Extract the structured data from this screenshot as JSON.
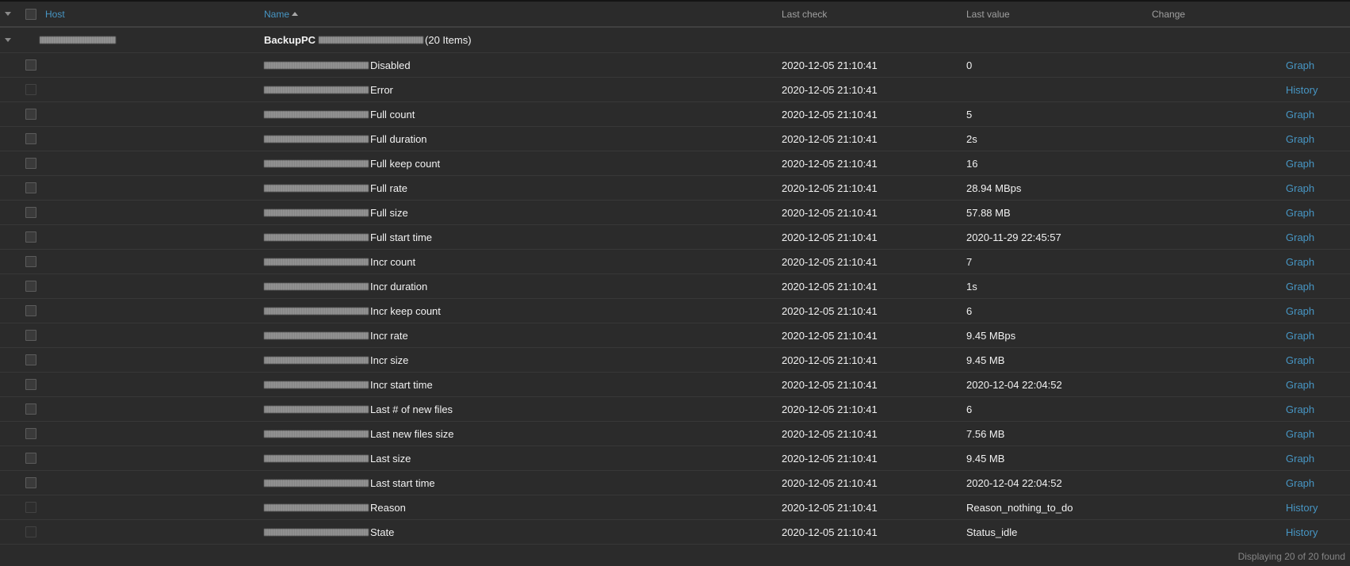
{
  "header": {
    "host": "Host",
    "name": "Name",
    "last_check": "Last check",
    "last_value": "Last value",
    "change": "Change"
  },
  "group": {
    "app_name": "BackupPC",
    "count": "(20 Items)"
  },
  "rows": [
    {
      "name": "Disabled",
      "last_check": "2020-12-05 21:10:41",
      "last_value": "0",
      "action": "Graph",
      "selectable": true
    },
    {
      "name": "Error",
      "last_check": "2020-12-05 21:10:41",
      "last_value": "",
      "action": "History",
      "selectable": false
    },
    {
      "name": "Full count",
      "last_check": "2020-12-05 21:10:41",
      "last_value": "5",
      "action": "Graph",
      "selectable": true
    },
    {
      "name": "Full duration",
      "last_check": "2020-12-05 21:10:41",
      "last_value": "2s",
      "action": "Graph",
      "selectable": true
    },
    {
      "name": "Full keep count",
      "last_check": "2020-12-05 21:10:41",
      "last_value": "16",
      "action": "Graph",
      "selectable": true
    },
    {
      "name": "Full rate",
      "last_check": "2020-12-05 21:10:41",
      "last_value": "28.94 MBps",
      "action": "Graph",
      "selectable": true
    },
    {
      "name": "Full size",
      "last_check": "2020-12-05 21:10:41",
      "last_value": "57.88 MB",
      "action": "Graph",
      "selectable": true
    },
    {
      "name": "Full start time",
      "last_check": "2020-12-05 21:10:41",
      "last_value": "2020-11-29 22:45:57",
      "action": "Graph",
      "selectable": true
    },
    {
      "name": "Incr count",
      "last_check": "2020-12-05 21:10:41",
      "last_value": "7",
      "action": "Graph",
      "selectable": true
    },
    {
      "name": "Incr duration",
      "last_check": "2020-12-05 21:10:41",
      "last_value": "1s",
      "action": "Graph",
      "selectable": true
    },
    {
      "name": "Incr keep count",
      "last_check": "2020-12-05 21:10:41",
      "last_value": "6",
      "action": "Graph",
      "selectable": true
    },
    {
      "name": "Incr rate",
      "last_check": "2020-12-05 21:10:41",
      "last_value": "9.45 MBps",
      "action": "Graph",
      "selectable": true
    },
    {
      "name": "Incr size",
      "last_check": "2020-12-05 21:10:41",
      "last_value": "9.45 MB",
      "action": "Graph",
      "selectable": true
    },
    {
      "name": "Incr start time",
      "last_check": "2020-12-05 21:10:41",
      "last_value": "2020-12-04 22:04:52",
      "action": "Graph",
      "selectable": true
    },
    {
      "name": "Last # of new files",
      "last_check": "2020-12-05 21:10:41",
      "last_value": "6",
      "action": "Graph",
      "selectable": true
    },
    {
      "name": "Last new files size",
      "last_check": "2020-12-05 21:10:41",
      "last_value": "7.56 MB",
      "action": "Graph",
      "selectable": true
    },
    {
      "name": "Last size",
      "last_check": "2020-12-05 21:10:41",
      "last_value": "9.45 MB",
      "action": "Graph",
      "selectable": true
    },
    {
      "name": "Last start time",
      "last_check": "2020-12-05 21:10:41",
      "last_value": "2020-12-04 22:04:52",
      "action": "Graph",
      "selectable": true
    },
    {
      "name": "Reason",
      "last_check": "2020-12-05 21:10:41",
      "last_value": "Reason_nothing_to_do",
      "action": "History",
      "selectable": false
    },
    {
      "name": "State",
      "last_check": "2020-12-05 21:10:41",
      "last_value": "Status_idle",
      "action": "History",
      "selectable": false
    }
  ],
  "footer": {
    "summary": "Displaying 20 of 20 found"
  },
  "colors": {
    "background": "#2b2b2b",
    "link": "#4796c4",
    "header_text": "#a0a0a0",
    "row_border": "#383838"
  },
  "icons": {
    "collapse_all": "chevron-down-icon",
    "group_toggle": "chevron-down-icon",
    "sort": "sort-ascending-icon"
  }
}
